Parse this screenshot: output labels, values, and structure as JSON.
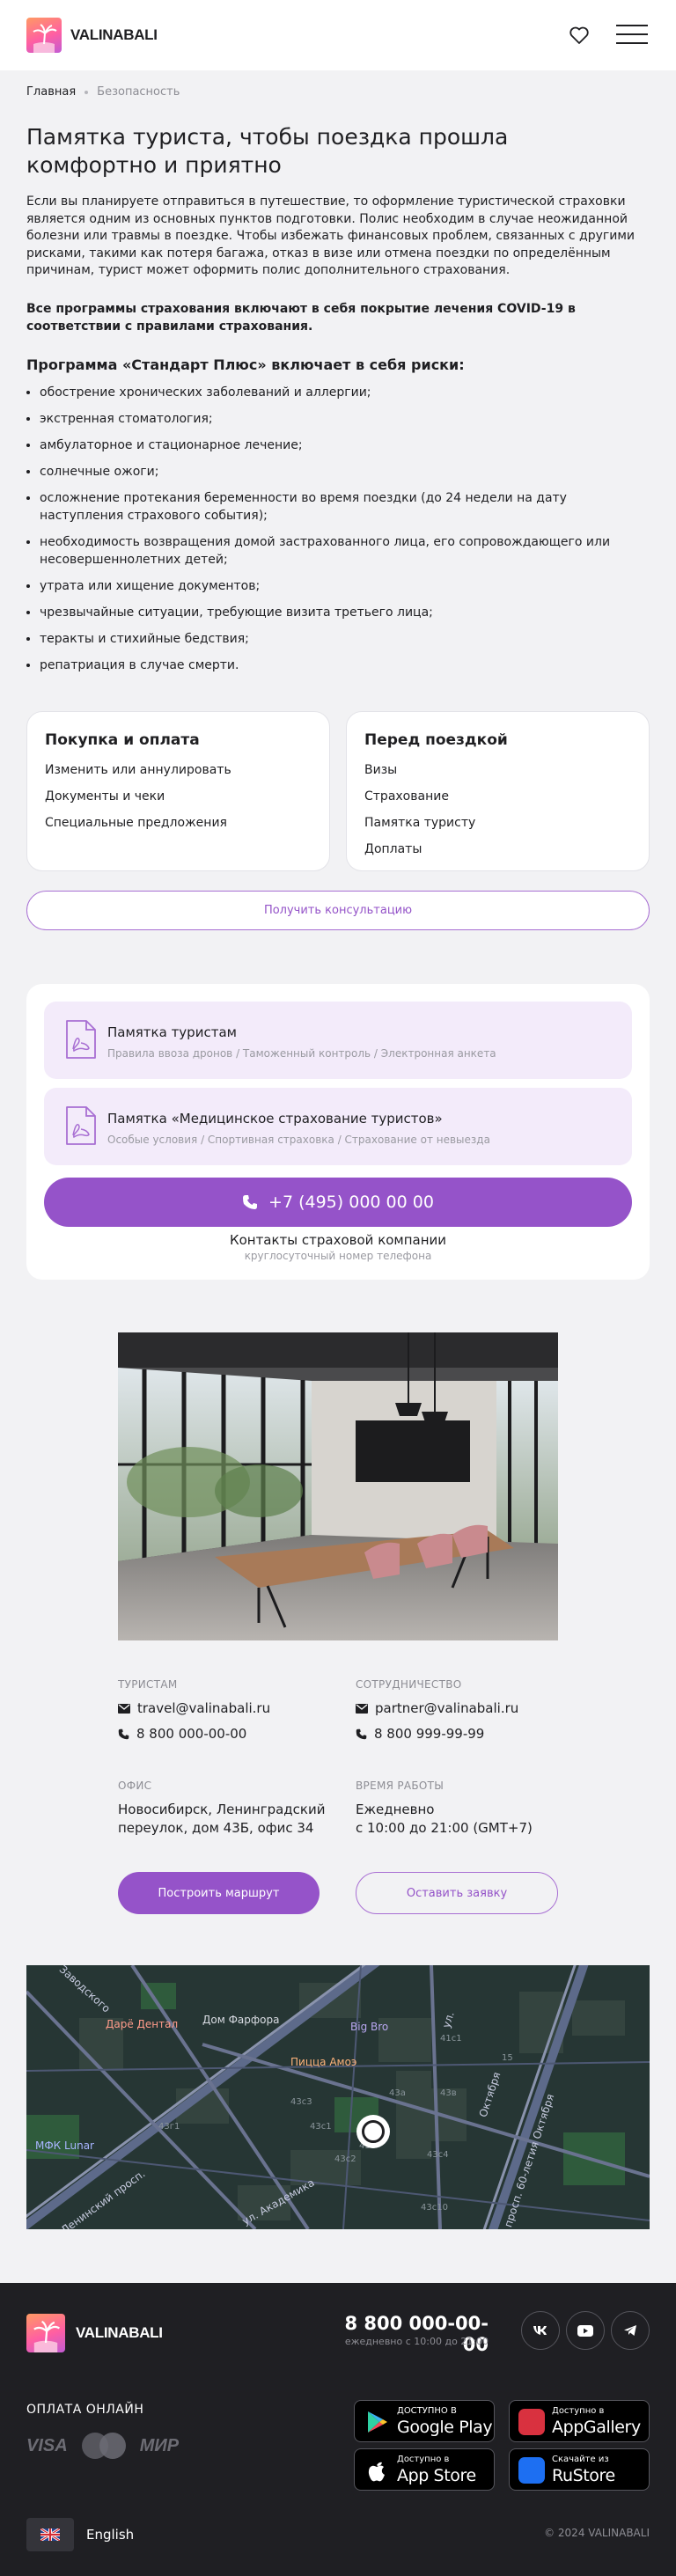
{
  "header": {
    "logo_text": "VALINABALI"
  },
  "breadcrumbs": [
    "Главная",
    "Безопасность"
  ],
  "article": {
    "title": "Памятка туриста, чтобы поездка прошла комфортно и приятно",
    "intro": "Если вы планируете отправиться в путешествие, то оформление туристической страховки является одним из основных пунктов подготовки. Полис необходим в случае неожиданной болезни или травмы в поездке. Чтобы избежать финансовых проблем, связанных с другими рисками, такими как потеря багажа, отказ в визе или отмена поездки по определённым причинам, турист может оформить полис дополнительного страхования.",
    "covid_note": "Все программы страхования включают в себя покрытие лечения COVID-19 в соответствии с правилами страхования.",
    "program_title": "Программа «Стандарт Плюс» включает в себя риски:",
    "risks": [
      "обострение хронических заболеваний и аллергии;",
      "экстренная стоматология;",
      "амбулаторное и стационарное лечение;",
      "солнечные ожоги;",
      "осложнение протекания беременности во время поездки (до 24 недели на дату наступления страхового события);",
      "необходимость возвращения домой застрахованного лица, его сопровождающего или несовершеннолетних детей;",
      "утрата или хищение документов;",
      "чрезвычайные ситуации, требующие визита третьего лица;",
      "теракты и стихийные бедствия;",
      "репатриация в случае смерти."
    ]
  },
  "cards": [
    {
      "title": "Покупка и оплата",
      "links": [
        "Изменить или аннулировать",
        "Документы и чеки",
        "Специальные предложения"
      ]
    },
    {
      "title": "Перед поездкой",
      "links": [
        "Визы",
        "Страхование",
        "Памятка туристу",
        "Доплаты"
      ]
    }
  ],
  "consult_button": "Получить консультацию",
  "memos": [
    {
      "title": "Памятка туристам",
      "subtitle": "Правила ввоза дронов / Таможенный контроль / Электронная анкета"
    },
    {
      "title": "Памятка «Медицинское страхование туристов»",
      "subtitle": "Особые условия / Спортивная страховка / Страхование от невыезда"
    }
  ],
  "insurance": {
    "phone": "+7 (495) 000 00 00",
    "contacts_label": "Контакты страховой компании",
    "contacts_sub": "круглосуточный номер телефона"
  },
  "office": {
    "tourists_label": "ТУРИСТАМ",
    "tourists_email": "travel@valinabali.ru",
    "tourists_phone": "8 800 000-00-00",
    "partners_label": "СОТРУДНИЧЕСТВО",
    "partners_email": "partner@valinabali.ru",
    "partners_phone": "8 800 999-99-99",
    "office_label": "ОФИС",
    "address_line1": "Новосибирск, Ленинградский",
    "address_line2": "переулок, дом 43Б, офис 34",
    "hours_label": "ВРЕМЯ РАБОТЫ",
    "hours_line1": "Ежедневно",
    "hours_line2": "с 10:00 до 21:00 (GMT+7)",
    "route_button": "Построить маршрут",
    "apply_button": "Оставить заявку"
  },
  "map": {
    "labels": [
      "Дарё Дентал",
      "Дом Фарфора",
      "Big Bro",
      "Пицца Амоэ",
      "МФК Lunar",
      "Ленинский просп.",
      "ул. Академика",
      "просп. 60-летия Октября",
      "Октября",
      "Заводского",
      "ул."
    ],
    "house_numbers": [
      "43с1",
      "43с2",
      "43с4",
      "43с3",
      "43г1",
      "43Б",
      "43а",
      "41с1",
      "43в",
      "43с10",
      "15"
    ]
  },
  "footer": {
    "logo_text": "VALINABALI",
    "phone": "8 800 000-00-00",
    "hours": "ежедневно с 10:00 до 21:00",
    "socials": [
      "vk-icon",
      "youtube-icon",
      "telegram-icon"
    ],
    "pay_title": "ОПЛАТА ОНЛАЙН",
    "pay_methods": [
      "VISA",
      "МИР"
    ],
    "stores": [
      {
        "small": "ДОСТУПНО В",
        "big": "Google Play"
      },
      {
        "small": "Доступно в",
        "big": "AppGallery"
      },
      {
        "small": "Доступно в",
        "big": "App Store"
      },
      {
        "small": "Скачайте из",
        "big": "RuStore"
      }
    ],
    "language": "English",
    "copyright": "© 2024 VALINABALI"
  },
  "colors": {
    "accent": "#9553c9",
    "accent_light": "#f3ebfa",
    "footer_bg": "#1f1f23"
  }
}
